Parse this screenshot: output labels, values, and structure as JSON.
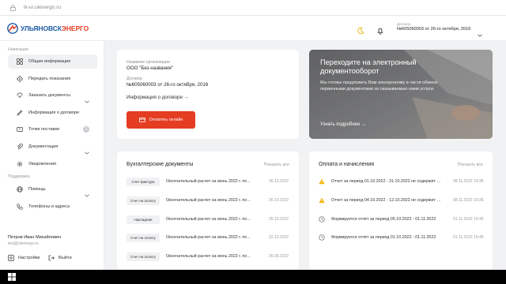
{
  "browser": {
    "url": "lk-ur.ulenergo.ru"
  },
  "header": {
    "logo_text_1": "УЛЬЯНОВСК",
    "logo_text_2": "ЭНЕРГО",
    "contract_label": "Договор",
    "contract_value": "№605060003 от 26-го октября, 2016",
    "icons": [
      "sun-icon",
      "bell-icon",
      "chevron-down-icon"
    ]
  },
  "sidebar": {
    "navigation_title": "Навигация",
    "items": [
      {
        "label": "Общая информация",
        "icon": "grid-icon",
        "active": true
      },
      {
        "label": "Передать показания",
        "icon": "meter-icon"
      },
      {
        "label": "Заказать документы",
        "icon": "document-icon",
        "chevron": true
      },
      {
        "label": "Информация о договоре",
        "icon": "contract-icon"
      },
      {
        "label": "Точки поставки",
        "icon": "plug-icon",
        "badge": "3"
      },
      {
        "label": "Документация",
        "icon": "paperclip-icon",
        "chevron": true
      },
      {
        "label": "Уведомления",
        "icon": "gear-icon"
      }
    ],
    "support_title": "Поддержка",
    "support_items": [
      {
        "label": "Помощь",
        "icon": "globe-icon",
        "chevron": true
      },
      {
        "label": "Телефоны и адреса",
        "icon": "phone-icon"
      }
    ],
    "user_name": "Петров Иван Михайлович",
    "user_email": "test@ulenergo.ru",
    "settings_label": "Настройки",
    "logout_label": "Выйти"
  },
  "org_card": {
    "org_label": "Название организации",
    "org_value": "ООО \"Без названия\"",
    "contract_label": "Договор",
    "contract_value": "№605060003 от 26-го октября, 2016",
    "info_link": "Информация о договоре →",
    "pay_button": "Оплатить онлайн"
  },
  "promo": {
    "title": "Переходите на электронный документооборот",
    "text": "Мы готовы предложить Вам альтернативу в части обмена первичными документами за оказываемые нами услуги.",
    "more": "Узнать подробнее →"
  },
  "docs": {
    "title": "Бухгалтерские документы",
    "show_all": "Показать все",
    "rows": [
      {
        "tag": "Счет-фактура",
        "text": "Окончательный расчет за июнь 2022 г. по...",
        "date": "26.10.2022"
      },
      {
        "tag": "Счет на оплату",
        "text": "Окончательный расчет за июнь 2022 г. по...",
        "date": "26.10.2022"
      },
      {
        "tag": "Накладная",
        "text": "Окончательный расчет за июнь 2022 г. по...",
        "date": "25.10.2022"
      },
      {
        "tag": "Счет на оплату",
        "text": "Окончательный расчет за июнь 2022 г. по...",
        "date": "22.10.2022"
      },
      {
        "tag": "Счет на оплату",
        "text": "Окончательный расчет за июнь 2022 г. по...",
        "date": "26.09.2022"
      }
    ]
  },
  "payments": {
    "title": "Оплата и начисления",
    "show_all": "Показать все",
    "rows": [
      {
        "icon": "warning-icon",
        "text": "Отчет за период 01.10.2022 - 31.10.2022 не содержит данн...",
        "date": "08.11.2022 19:36"
      },
      {
        "icon": "warning-icon",
        "text": "Отчет за период 04.10.2022 - 12.10.2022 не содержит данн...",
        "date": "08.11.2022 19:36"
      },
      {
        "icon": "clock-icon",
        "text": "Формируется отчёт за период 05.10.2022 - 01.11.2022",
        "date": "01.11.2022 15:46"
      },
      {
        "icon": "clock-icon",
        "text": "Формируется отчёт за период 01.10.2022 - 01.11.2022",
        "date": "01.11.2022 15:46"
      }
    ]
  },
  "colors": {
    "brand_red": "#e43d22",
    "brand_blue": "#1d5aa6",
    "warning": "#f2b200"
  }
}
